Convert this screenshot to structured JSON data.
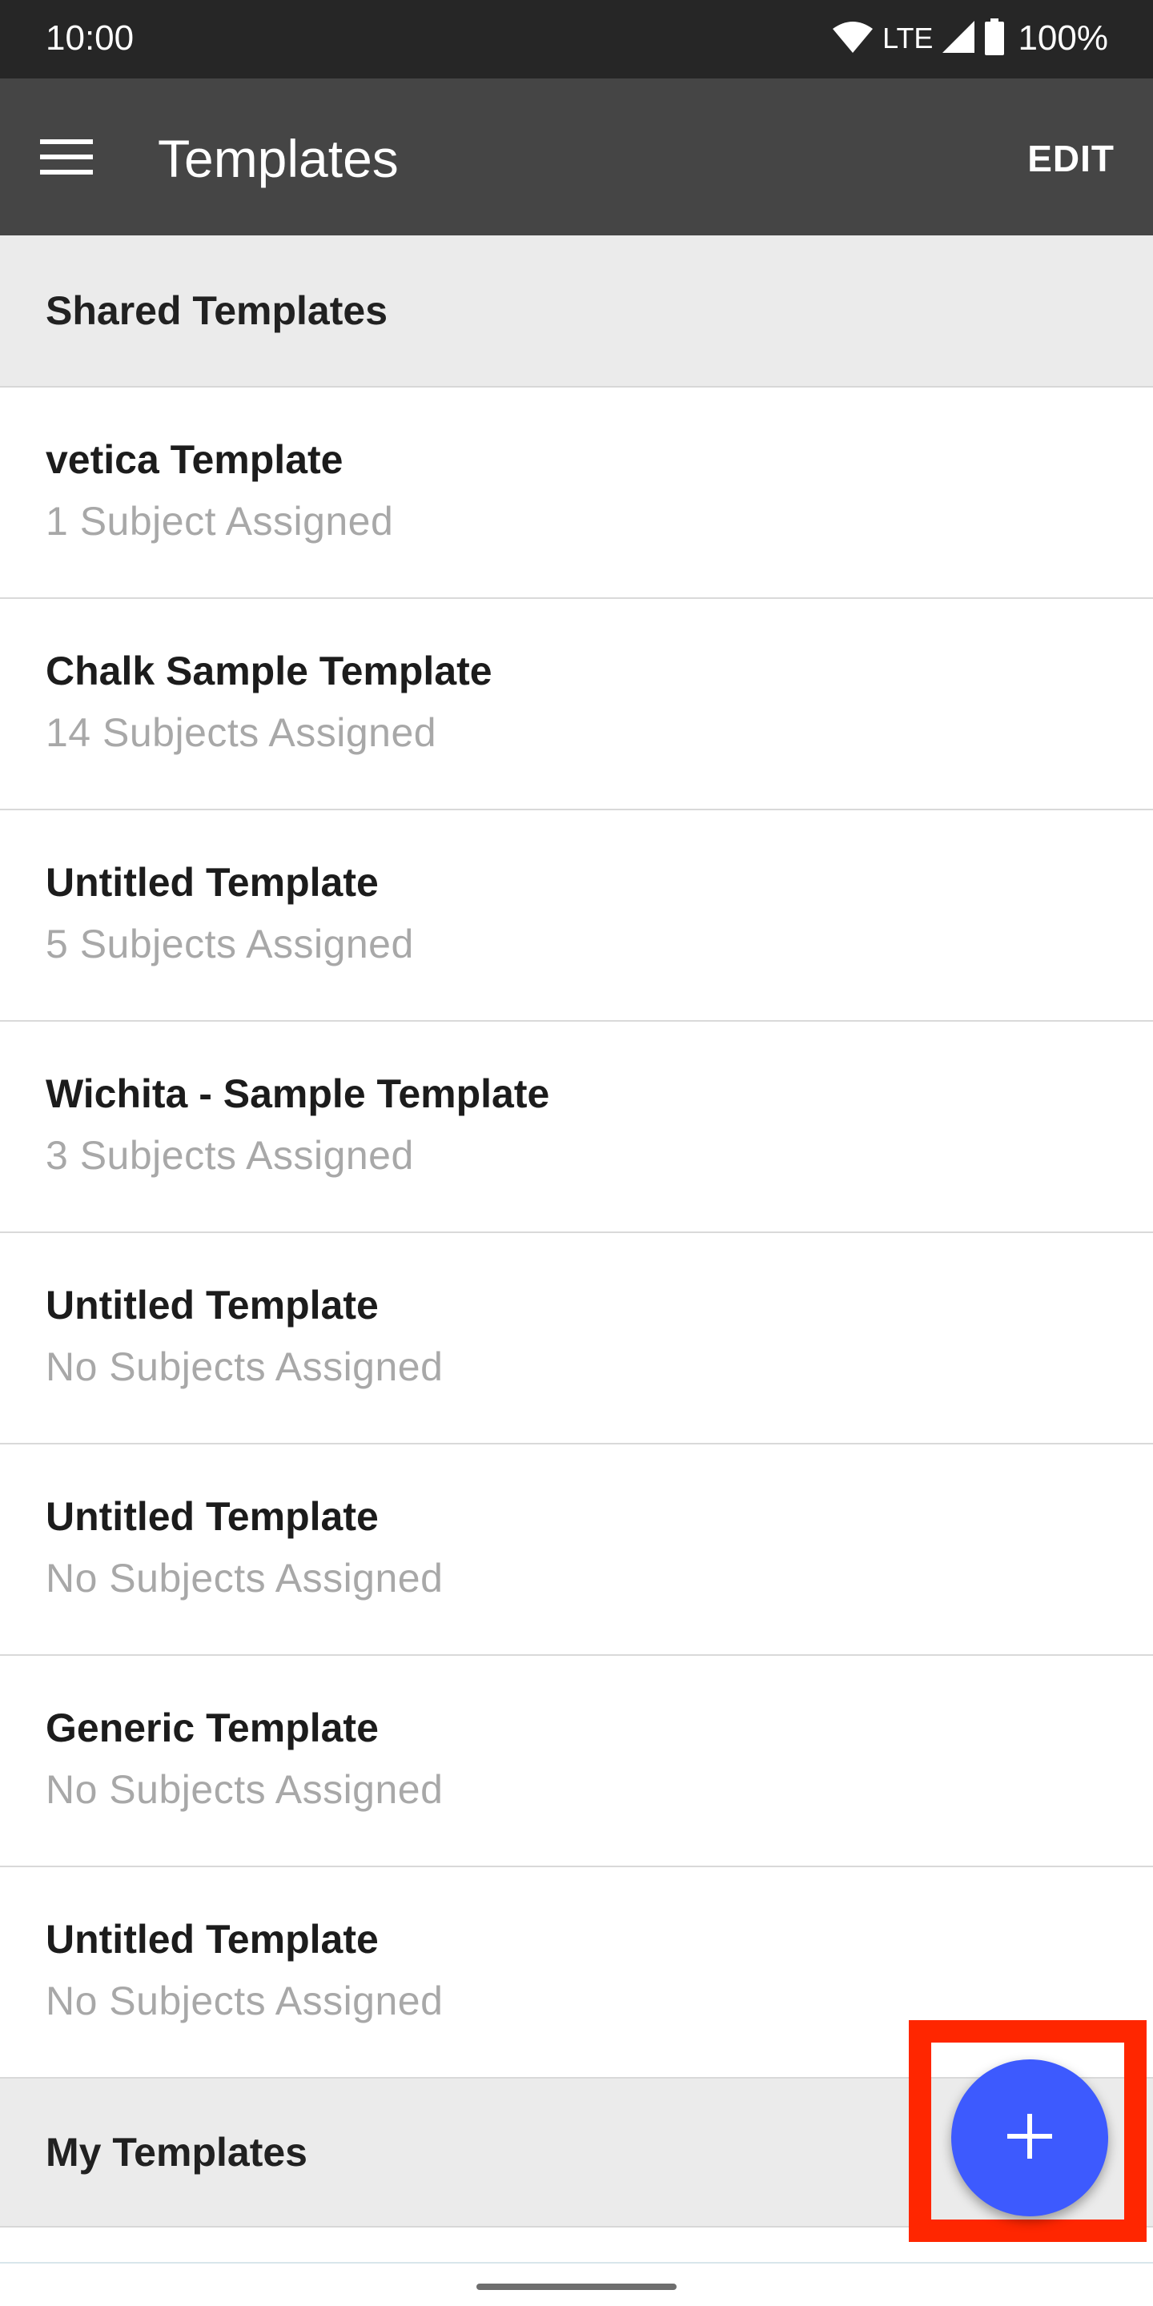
{
  "status_bar": {
    "time": "10:00",
    "network": "LTE",
    "battery": "100%",
    "icons": [
      "wifi-icon",
      "cell-signal-icon",
      "battery-icon"
    ]
  },
  "app_bar": {
    "menu_icon": "hamburger-menu-icon",
    "title": "Templates",
    "edit_label": "EDIT"
  },
  "sections": {
    "shared": {
      "title": "Shared Templates",
      "items": [
        {
          "title": "vetica Template",
          "subtitle": "1 Subject Assigned"
        },
        {
          "title": "Chalk Sample Template",
          "subtitle": "14 Subjects Assigned"
        },
        {
          "title": "Untitled Template",
          "subtitle": "5 Subjects Assigned"
        },
        {
          "title": "Wichita - Sample Template",
          "subtitle": "3 Subjects Assigned"
        },
        {
          "title": "Untitled Template",
          "subtitle": "No Subjects Assigned"
        },
        {
          "title": "Untitled Template",
          "subtitle": "No Subjects Assigned"
        },
        {
          "title": "Generic Template",
          "subtitle": "No Subjects Assigned"
        },
        {
          "title": "Untitled Template",
          "subtitle": "No Subjects Assigned"
        }
      ]
    },
    "mine": {
      "title": "My Templates"
    }
  },
  "fab": {
    "icon": "plus-icon"
  },
  "colors": {
    "status_bar": "#262626",
    "app_bar": "#454545",
    "section_bg": "#ebebeb",
    "fab": "#3d5afe",
    "highlight": "#ff2600",
    "subtitle_text": "#a8a8a8"
  }
}
